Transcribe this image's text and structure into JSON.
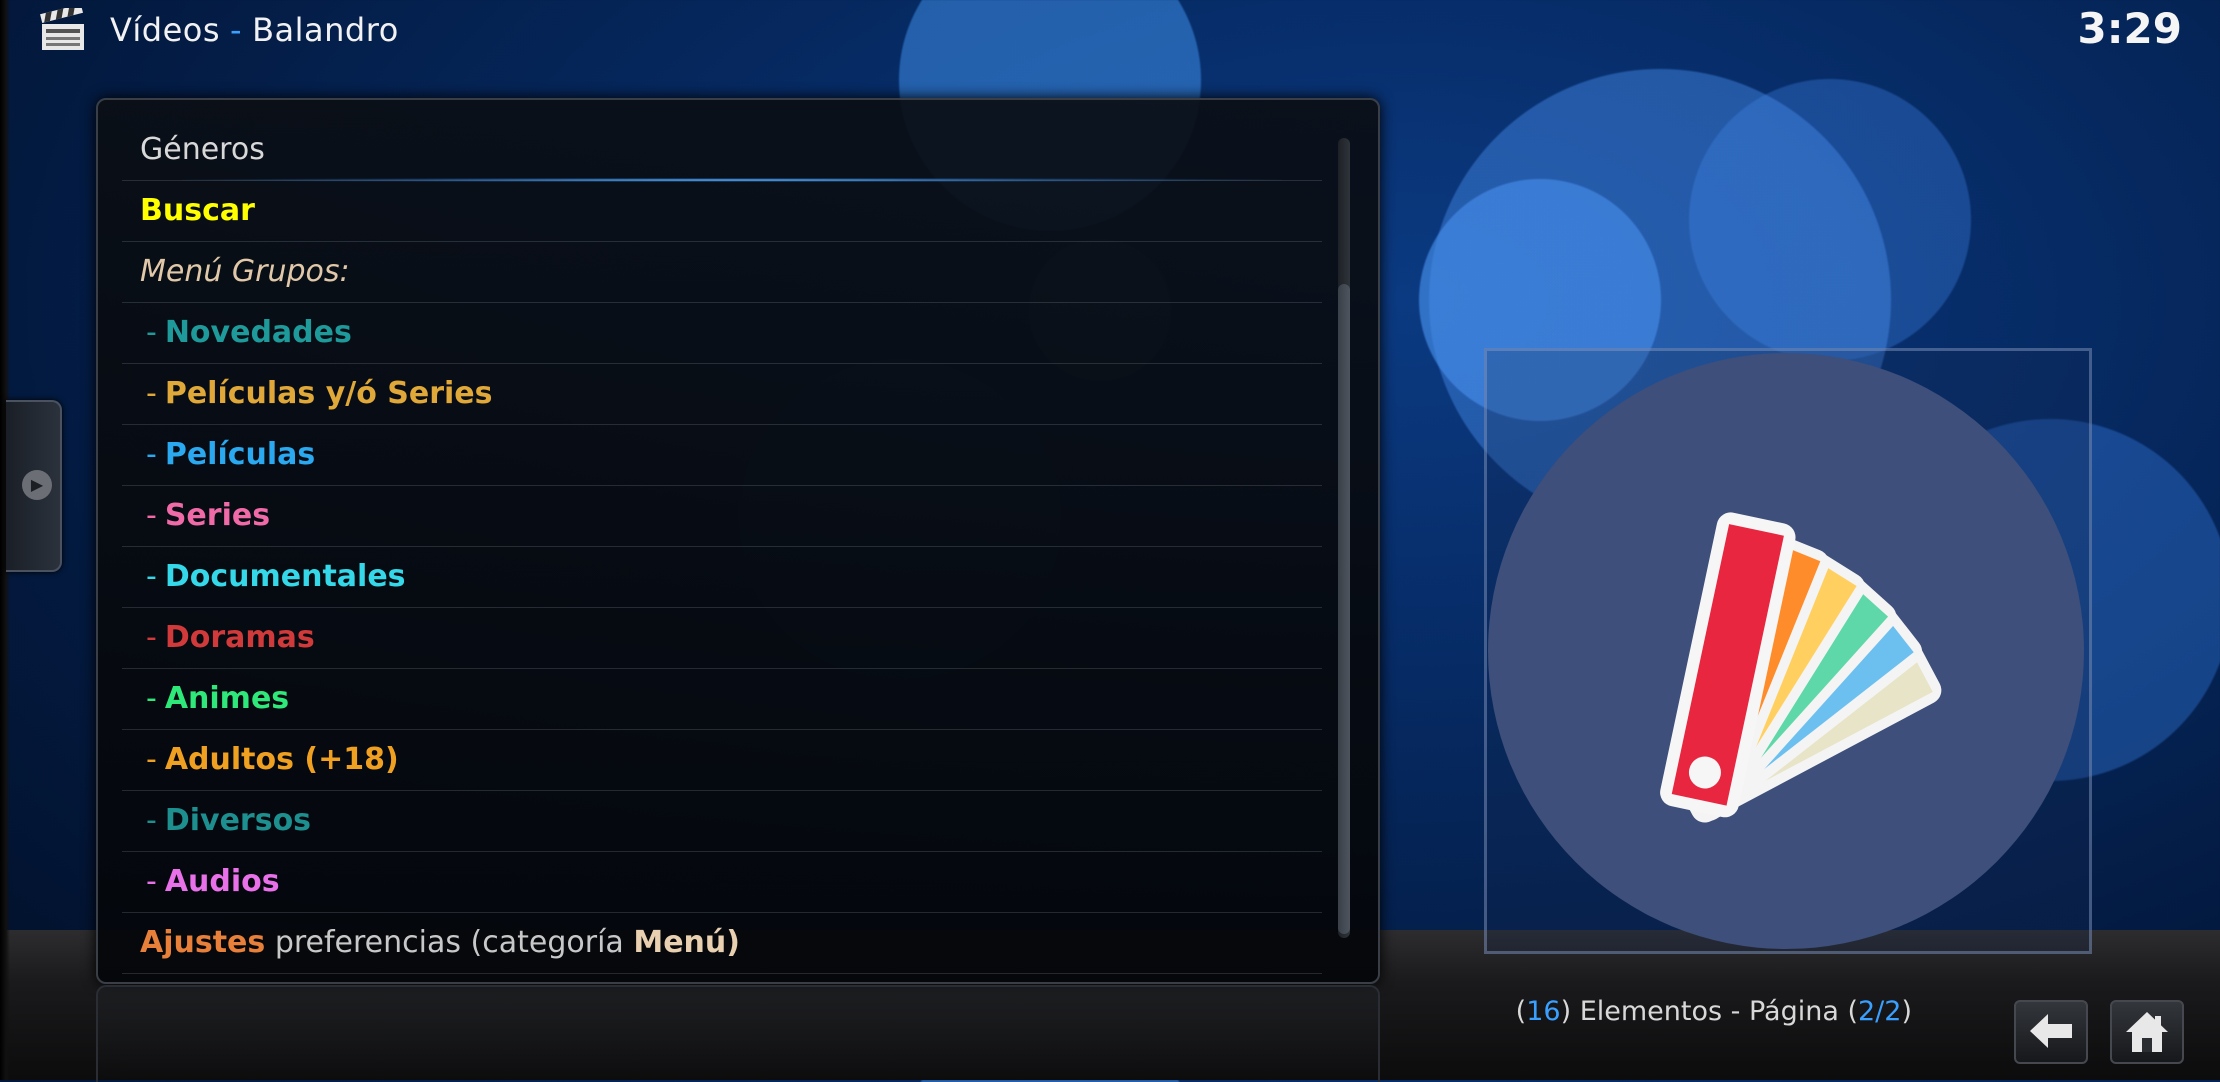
{
  "header": {
    "section": "Vídeos",
    "separator": "-",
    "addon": "Balandro",
    "clock": "3:29"
  },
  "list": {
    "title": "Géneros",
    "search": "Buscar",
    "groups_label": "Menú Grupos:",
    "dash": "-",
    "items": [
      {
        "label": "Novedades",
        "color": "#1e9a9a"
      },
      {
        "label": "Películas y/ó Series",
        "color": "#e0a838"
      },
      {
        "label": "Películas",
        "color": "#2aa8f0"
      },
      {
        "label": "Series",
        "color": "#f06aa8"
      },
      {
        "label": "Documentales",
        "color": "#34d8e8"
      },
      {
        "label": "Doramas",
        "color": "#d03a3a"
      },
      {
        "label": "Animes",
        "color": "#2ee87a"
      },
      {
        "label": "Adultos (+18)",
        "color": "#f0a020"
      },
      {
        "label": "Diversos",
        "color": "#1e8f8f"
      },
      {
        "label": "Audios",
        "color": "#e870e8"
      }
    ],
    "settings": {
      "word1": "Ajustes",
      "word2": "preferencias (categoría",
      "word3": "Menú)"
    }
  },
  "footer": {
    "open_paren": "(",
    "count": "16",
    "text1": ") Elementos - Página (",
    "page": "2/2",
    "close_paren": ")"
  },
  "colors": {
    "search": "#ffff00",
    "groups_label": "#e0c8a8",
    "settings_word1": "#e8803a",
    "settings_word2": "#c8c8c8",
    "settings_word3": "#e8d0b0",
    "accent": "#3aa0ff",
    "thumb_circle": "#3d4f7a"
  },
  "icons": {
    "header": "clapperboard-icon",
    "side": "play-arrow-icon",
    "thumb": "color-swatch-icon",
    "back": "back-arrow-icon",
    "home": "home-icon"
  }
}
